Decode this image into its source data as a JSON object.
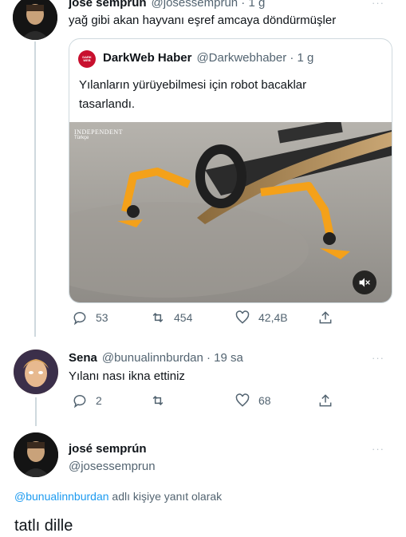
{
  "tweet1": {
    "name": "josé semprún",
    "handle": "@josessemprun · 1 g",
    "text": "yağ gibi akan hayvanı eşref amcaya döndürmüşler",
    "more": "···"
  },
  "quoted": {
    "avatar_text": "DARK WEB",
    "name": "DarkWeb Haber",
    "handle": "@Darkwebhaber · 1 g",
    "text": "Yılanların yürüyebilmesi için robot bacaklar tasarlandı.",
    "media": {
      "watermark": "INDEPENDENT",
      "watermark_sub": "Türkçe"
    }
  },
  "tweet1_actions": {
    "reply": "53",
    "retweet": "454",
    "like": "42,4B"
  },
  "tweet2": {
    "name": "Sena",
    "handle": "@bunualinnburdan · 19 sa",
    "text": "Yılanı nası ikna ettiniz",
    "more": "···",
    "reply": "2",
    "like": "68"
  },
  "tweet3": {
    "name": "josé semprún",
    "handle": "@josessemprun",
    "more": "···",
    "reply_to_mention": "@bunualinnburdan",
    "reply_to_suffix": " adlı kişiye yanıt olarak",
    "text": "tatlı dille"
  },
  "colors": {
    "accent": "#1d9bf0",
    "secondary_text": "#536471",
    "robot_orange": "#f4a11a"
  }
}
